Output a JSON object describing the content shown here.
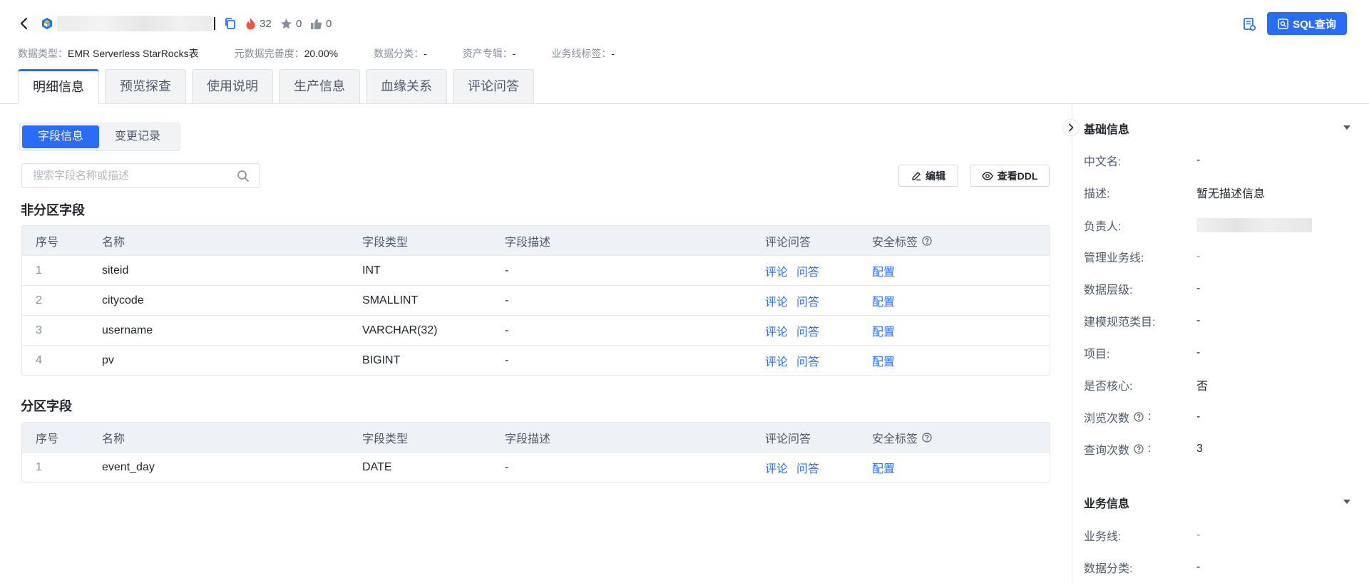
{
  "header": {
    "likes_count": "0",
    "hot_count": "32",
    "favorites_count": "0",
    "sql_button_label": "SQL查询"
  },
  "meta": [
    {
      "key": "数据类型：",
      "value": "EMR Serverless StarRocks表"
    },
    {
      "key": "元数据完善度：",
      "value": "20.00%"
    },
    {
      "key": "数据分类：",
      "value": "-"
    },
    {
      "key": "资产专辑：",
      "value": "-"
    },
    {
      "key": "业务线标签：",
      "value": "-"
    }
  ],
  "tabs": [
    {
      "label": "明细信息",
      "active": true
    },
    {
      "label": "预览探查"
    },
    {
      "label": "使用说明"
    },
    {
      "label": "生产信息"
    },
    {
      "label": "血缘关系"
    },
    {
      "label": "评论问答"
    }
  ],
  "segment": {
    "fields": "字段信息",
    "changes": "变更记录"
  },
  "search": {
    "placeholder": "搜索字段名称或描述"
  },
  "toolbar": {
    "edit_label": "编辑",
    "ddl_label": "查看DDL"
  },
  "columns": {
    "index": "序号",
    "name": "名称",
    "type": "字段类型",
    "desc": "字段描述",
    "comments": "评论问答",
    "security": "安全标签"
  },
  "actions": {
    "comment": "评论",
    "qa": "问答",
    "config": "配置"
  },
  "non_partition": {
    "title": "非分区字段",
    "rows": [
      {
        "index": "1",
        "name": "siteid",
        "type": "INT",
        "desc": "-"
      },
      {
        "index": "2",
        "name": "citycode",
        "type": "SMALLINT",
        "desc": "-"
      },
      {
        "index": "3",
        "name": "username",
        "type": "VARCHAR(32)",
        "desc": "-"
      },
      {
        "index": "4",
        "name": "pv",
        "type": "BIGINT",
        "desc": "-"
      }
    ]
  },
  "partition": {
    "title": "分区字段",
    "rows": [
      {
        "index": "1",
        "name": "event_day",
        "type": "DATE",
        "desc": "-"
      }
    ]
  },
  "basic_info": {
    "title": "基础信息",
    "items": [
      {
        "key": "中文名:",
        "value": "-"
      },
      {
        "key": "描述:",
        "value": "暂无描述信息"
      },
      {
        "key": "负责人:",
        "value": ""
      },
      {
        "key": "管理业务线:",
        "value": "-"
      },
      {
        "key": "数据层级:",
        "value": "-"
      },
      {
        "key": "建模规范类目:",
        "value": "-"
      },
      {
        "key": "项目:",
        "value": "-"
      },
      {
        "key": "是否核心:",
        "value": "否"
      },
      {
        "key": "浏览次数",
        "value": "-",
        "help": true
      },
      {
        "key": "查询次数",
        "value": "3",
        "help": true
      }
    ]
  },
  "business_info": {
    "title": "业务信息",
    "items": [
      {
        "key": "业务线:",
        "value": "-"
      },
      {
        "key": "数据分类:",
        "value": "-"
      }
    ]
  },
  "colors": {
    "accent": "#2b6cf6",
    "hot": "#f5533d",
    "muted": "#86909c"
  }
}
